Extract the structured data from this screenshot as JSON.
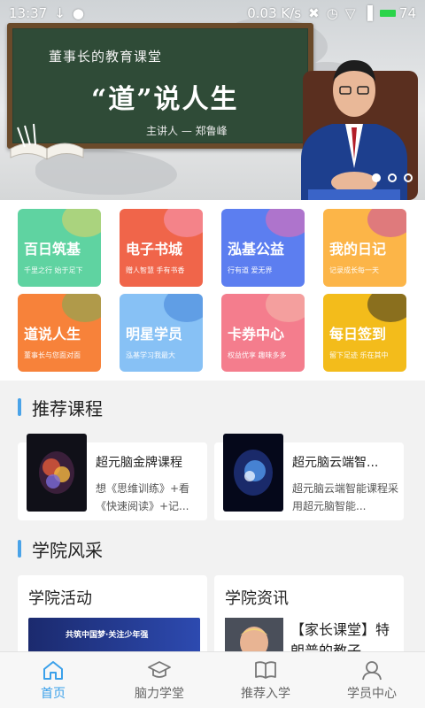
{
  "statusbar": {
    "time": "13:37",
    "speed": "0.03",
    "speed_unit": "K/s",
    "battery": "74"
  },
  "banner": {
    "board_line1": "董事长的教育课堂",
    "board_title": "“道”说人生",
    "board_speaker": "主讲人 — 郑鲁峰"
  },
  "tiles": [
    {
      "title": "百日筑基",
      "sub": "千里之行 始于足下",
      "color": "#5fd3a1"
    },
    {
      "title": "电子书城",
      "sub": "赠人智慧 手有书香",
      "color": "#f0654a"
    },
    {
      "title": "泓基公益",
      "sub": "行有道 爱无界",
      "color": "#5c7ef0"
    },
    {
      "title": "我的日记",
      "sub": "记录成长每一天",
      "color": "#fcb548"
    },
    {
      "title": "道说人生",
      "sub": "董事长与您面对面",
      "color": "#f7823a"
    },
    {
      "title": "明星学员",
      "sub": "泓基学习我最大",
      "color": "#87c1f5"
    },
    {
      "title": "卡券中心",
      "sub": "权益优享 趣味多多",
      "color": "#f47d8d"
    },
    {
      "title": "每日签到",
      "sub": "留下足迹 乐在其中",
      "color": "#f3bc1b"
    }
  ],
  "recommended": {
    "title": "推荐课程",
    "courses": [
      {
        "name": "超元脑金牌课程",
        "desc": "想《思维训练》+看《快速阅读》+记..."
      },
      {
        "name": "超元脑云端智...",
        "desc": "超元脑云端智能课程采用超元脑智能..."
      }
    ]
  },
  "college": {
    "title": "学院风采",
    "activity_title": "学院活动",
    "activity_banner": "共筑中国梦·关注少年强",
    "news_title": "学院资讯",
    "news_text": "【家长课堂】特朗普的教子"
  },
  "nav": {
    "items": [
      {
        "label": "首页",
        "icon": "home-icon"
      },
      {
        "label": "脑力学堂",
        "icon": "graduation-cap-icon"
      },
      {
        "label": "推荐入学",
        "icon": "book-icon"
      },
      {
        "label": "学员中心",
        "icon": "user-icon"
      }
    ]
  },
  "colors": {
    "accent": "#3aa0ea",
    "section_bar": "#4aa3e8"
  }
}
